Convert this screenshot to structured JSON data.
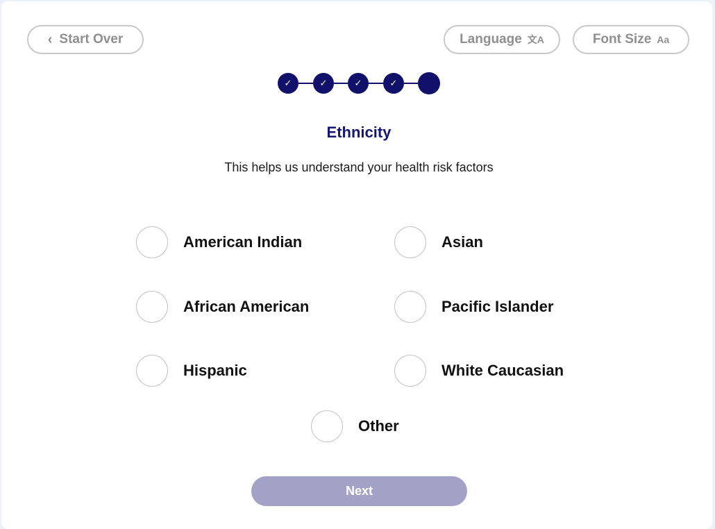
{
  "header": {
    "start_over_label": "Start Over",
    "language_label": "Language",
    "language_icon": "文A",
    "font_size_label": "Font Size",
    "font_size_icon": "Aa"
  },
  "stepper": {
    "steps": [
      {
        "state": "complete",
        "icon": "✓"
      },
      {
        "state": "complete",
        "icon": "✓"
      },
      {
        "state": "complete",
        "icon": "✓"
      },
      {
        "state": "complete",
        "icon": "✓"
      },
      {
        "state": "current",
        "icon": ""
      }
    ]
  },
  "question": {
    "title": "Ethnicity",
    "subtitle": "This helps us understand your health risk factors"
  },
  "options": [
    {
      "label": "American Indian",
      "selected": false
    },
    {
      "label": "Asian",
      "selected": false
    },
    {
      "label": "African American",
      "selected": false
    },
    {
      "label": "Pacific Islander",
      "selected": false
    },
    {
      "label": "Hispanic",
      "selected": false
    },
    {
      "label": "White Caucasian",
      "selected": false
    },
    {
      "label": "Other",
      "selected": false
    }
  ],
  "footer": {
    "next_label": "Next"
  },
  "colors": {
    "primary": "#11116b",
    "title": "#161675",
    "next_disabled": "#a2a2c7",
    "pill_border": "#c9c9c9"
  }
}
